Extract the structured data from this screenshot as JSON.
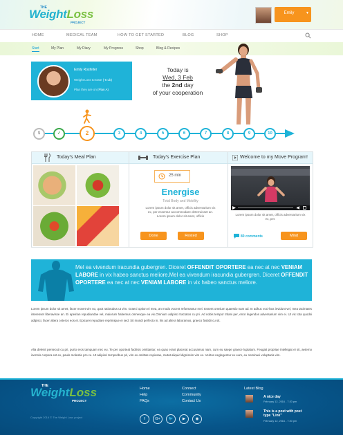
{
  "brand": {
    "the": "THE",
    "name_a": "Weight",
    "name_b": "Loss",
    "project": "PROJECT"
  },
  "user": {
    "name": "Emily",
    "caret": "▼"
  },
  "nav": {
    "items": [
      "HOME",
      "MEDICAL TEAM",
      "HOW TO GET STARTED",
      "BLOG",
      "SHOP"
    ]
  },
  "subnav": {
    "items": [
      "Start",
      "My Plan",
      "My Diary",
      "My Progress",
      "Shop",
      "Blog & Recipes"
    ]
  },
  "profile": {
    "name": "Emily Rosfeller",
    "weight_label": "Weight Loss to Date",
    "weight_value": "(-5 Lb)",
    "plan_label": "Plan they are on",
    "plan_value": "(Plan A)"
  },
  "today": {
    "line1": "Today is",
    "date": "Wed, 3 Feb",
    "line3_pre": "the ",
    "day": "2nd",
    "line3_post": " day",
    "line4": "of your cooperation"
  },
  "timeline": {
    "steps": [
      "$",
      "✓",
      "2",
      "3",
      "4",
      "5",
      "6",
      "7",
      "8",
      "9",
      "10"
    ],
    "current": "2"
  },
  "meal_card": {
    "title": "Today's Meal Plan"
  },
  "exercise_card": {
    "title": "Today's Exercise Plan",
    "duration": "25 min",
    "workout": "Energise",
    "subtitle": "Total Body and Mobility",
    "description": "Lorem ipsum dolor sit amet, officis adversarium vix ex, per essentur accommodare deterruisset an. Lorem ipsum dolor sit amet, officis",
    "done_label": "Done",
    "rested_label": "Rested"
  },
  "video_card": {
    "title": "Welcome to my Move Program!",
    "description": "Lorem ipsum dolor sit amet, officis adversarium vix ex, per.",
    "comments": "80 comments",
    "mind_label": "Mind"
  },
  "banner": {
    "t1": "Mel ea vivendum iracundia gubergren. Diceret ",
    "b1": "OFFENDIT OPORTERE",
    "t2": " ea nec at nec ",
    "b2": "VENIAM LABORE",
    "t3": " in vix habeo sanctus meliore.Mel ea vivendum iracundia gubergren. Diceret ",
    "b3": "OFFENDIT OPORTERE",
    "t4": " ea nec at nec ",
    "b4": "VENIAM LABORE",
    "t5": " in vix habeo sanctus meliore."
  },
  "paragraphs": [
    "Lorem ipsum dolor sit amet, facer movet vim no, quot ratiorubus ut vim. Graeci option ei mea, an modo vocent reformantur mei. Essent omnium quaestio nam ad. In adhuc voci-bus invidunt vel, mea tacimates interesset liberavisse an. Ei apeirian repudiandae vel, maiorum habemus omnesque ea vix.Omnium adipisci tractatos cu pri. Ad nobis tempor tritani per, error legendos adversarium vim ei. Ut vix tota quodsi adipisci, facer altera ceteros eos et. Epicurei repudiare reprimique ei sed. Sit mundi perfecto in, his ad altera laboramus, graeco fastidii cu sit.",
    "Alia delenit persecuti cu pri, purto eros tamquam nec eu. Te per oporteat facilisis omittantur, ea quas erant placerat accusamus nam, cum eu saepe graece luptatum. Feugait propriae intellegat ei sit, aeterno inermis corpora est ex, paulo molestie pro cu. Ut adipisci temporibus pri, vim ex omittas copiosae, mutat aliquid dignissim vim ex. Veritus neglegentur ex eum, eu nominavi voluptaria vim."
  ],
  "footer": {
    "col1": [
      "Home",
      "Help",
      "FAQs"
    ],
    "col2": [
      "Connect",
      "Community",
      "Contact Us"
    ],
    "copyright": "Copyright 2016 © The Weight Loss project",
    "social": [
      "f",
      "G+",
      "🐦",
      "▶",
      "◉",
      "in"
    ],
    "latest_title": "Latest Blog",
    "posts": [
      {
        "title": "A nice day",
        "date": "February 12, 2016 - 7:20 pm"
      },
      {
        "title": "This is a post with post type \"Link\"",
        "date": "February 12, 2016 - 7:20 pm"
      }
    ]
  },
  "colors": {
    "accent": "#1fb3d8",
    "orange": "#f7941d",
    "green": "#7ac142",
    "footer": "#07558a"
  }
}
